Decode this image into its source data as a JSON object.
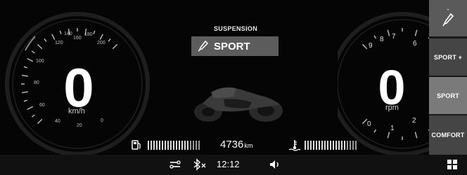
{
  "speedometer": {
    "value": "0",
    "unit": "km/h",
    "tick_labels": [
      "0",
      "20",
      "40",
      "60",
      "80",
      "100",
      "120",
      "140",
      "160",
      "180",
      "200"
    ]
  },
  "tachometer": {
    "value": "0",
    "unit": "rpm",
    "tick_labels": [
      "0",
      "1",
      "2",
      "6",
      "7",
      "8",
      "9"
    ]
  },
  "suspension": {
    "title": "SUSPENSION",
    "mode": "SPORT",
    "icon": "suspension-icon"
  },
  "odometer": {
    "value": "4736",
    "unit": "km"
  },
  "fuel": {
    "icon": "fuel-icon",
    "level_fraction": 0.8
  },
  "coolant": {
    "icon": "coolant-temp-icon",
    "level_fraction": 0.8
  },
  "side_menu": {
    "top_icon": "suspension-icon",
    "items": [
      {
        "label": "SPORT +",
        "active": false
      },
      {
        "label": "SPORT",
        "active": true
      },
      {
        "label": "COMFORT",
        "active": false
      }
    ]
  },
  "status_bar": {
    "connect_icon": "link-icon",
    "bluetooth_icon": "bluetooth-off-icon",
    "time": "12:12",
    "volume_icon": "speaker-icon",
    "menu_icon": "grid-menu-icon"
  },
  "colors": {
    "background": "#000000",
    "panel_active": "#7a7a7a",
    "panel_inactive": "#454545",
    "suspension_box": "#5c5c5c"
  }
}
